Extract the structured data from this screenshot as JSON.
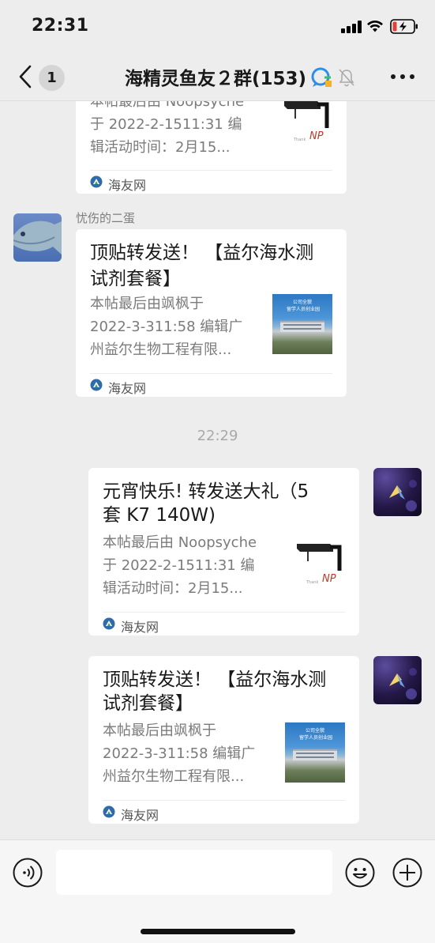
{
  "status_bar": {
    "time": "22:31"
  },
  "header": {
    "unread_count": "1",
    "title": "海精灵鱼友２群(153)"
  },
  "colors": {
    "background": "#ededed",
    "card": "#ffffff",
    "source_brand": "#2f6aa9"
  },
  "messages": [
    {
      "type": "link-card",
      "side": "left",
      "title": "",
      "desc": [
        "本帖最后由 Noopsyche",
        "于 2022-2-1511:31 编",
        "辑活动时间：2月15..."
      ],
      "thumb": "aquarium-light",
      "source": "海友网"
    },
    {
      "type": "link-card",
      "side": "left",
      "sender": "忧伤的二蛋",
      "title": [
        "顶贴转发送！ 【益尔海水测",
        "试剂套餐】"
      ],
      "desc": [
        "本帖最后由飒枫于",
        "2022-3-311:58 编辑广",
        "州益尔生物工程有限..."
      ],
      "thumb": "company-building",
      "thumb_text": [
        "公司全貌",
        "留学人员创业园"
      ],
      "source": "海友网"
    },
    {
      "type": "time",
      "text": "22:29"
    },
    {
      "type": "link-card",
      "side": "right",
      "title": [
        "元宵快乐! 转发送大礼（5",
        "套 K7  140W)"
      ],
      "desc": [
        "本帖最后由 Noopsyche",
        "于 2022-2-1511:31 编",
        "辑活动时间：2月15..."
      ],
      "thumb": "aquarium-light",
      "source": "海友网"
    },
    {
      "type": "link-card",
      "side": "right",
      "title": [
        "顶贴转发送！ 【益尔海水测",
        "试剂套餐】"
      ],
      "desc": [
        "本帖最后由飒枫于",
        "2022-3-311:58 编辑广",
        "州益尔生物工程有限..."
      ],
      "thumb": "company-building",
      "thumb_text": [
        "公司全貌",
        "留学人员创业园"
      ],
      "source": "海友网"
    }
  ],
  "input": {
    "value": "",
    "placeholder": ""
  }
}
